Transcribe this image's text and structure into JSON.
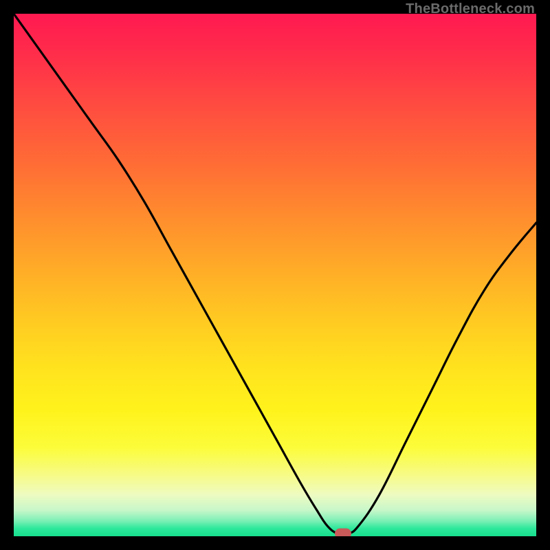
{
  "watermark": {
    "text": "TheBottleneck.com"
  },
  "chart_data": {
    "type": "line",
    "title": "",
    "xlabel": "",
    "ylabel": "",
    "xlim": [
      0,
      100
    ],
    "ylim": [
      0,
      100
    ],
    "grid": false,
    "legend": null,
    "series": [
      {
        "name": "bottleneck-curve",
        "color": "#000000",
        "smooth": true,
        "x": [
          0,
          5,
          10,
          15,
          20,
          25,
          30,
          35,
          40,
          45,
          50,
          55,
          58,
          60,
          62,
          64,
          66,
          70,
          75,
          80,
          85,
          90,
          95,
          100
        ],
        "y": [
          100,
          93,
          86,
          79,
          72,
          64,
          55,
          46,
          37,
          28,
          19,
          10,
          5,
          2,
          0.5,
          0.5,
          2,
          8,
          18,
          28,
          38,
          47,
          54,
          60
        ]
      }
    ],
    "annotations": [
      {
        "name": "min-marker",
        "x": 63,
        "y": 0.5,
        "color": "#c85a5a"
      }
    ],
    "background_gradient_stops": [
      {
        "pct": 0,
        "color": "#ff1951"
      },
      {
        "pct": 50,
        "color": "#ffc822"
      },
      {
        "pct": 80,
        "color": "#fff31c"
      },
      {
        "pct": 100,
        "color": "#17df8d"
      }
    ]
  },
  "colors": {
    "stage_bg": "#000000",
    "curve": "#000000",
    "marker": "#c85a5a",
    "watermark": "#6b6b6b"
  }
}
